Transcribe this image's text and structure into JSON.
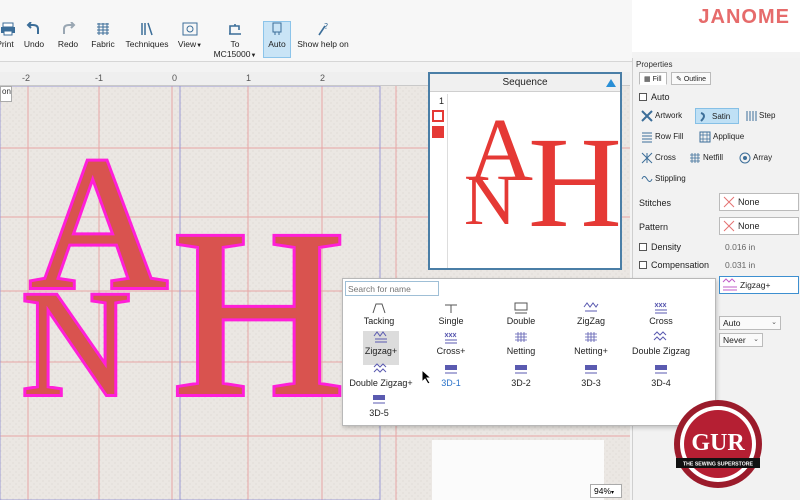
{
  "brand": "JANOME",
  "toolbar": {
    "items": [
      {
        "label": "Print",
        "icon": "print-icon"
      },
      {
        "label": "Undo",
        "icon": "undo-icon"
      },
      {
        "label": "Redo",
        "icon": "redo-icon"
      },
      {
        "label": "Fabric",
        "icon": "fabric-icon"
      },
      {
        "label": "Techniques",
        "icon": "techniques-icon"
      },
      {
        "label": "View",
        "icon": "view-icon"
      },
      {
        "label": "To MC15000",
        "icon": "machine-icon"
      },
      {
        "label": "Auto",
        "icon": "auto-icon",
        "active": true
      },
      {
        "label": "Show help on",
        "icon": "help-icon"
      }
    ]
  },
  "ruler": {
    "ticks": [
      "-2",
      "-1",
      "0",
      "1",
      "2"
    ]
  },
  "left_button": "on",
  "sequence": {
    "title": "Sequence",
    "item_number": "1",
    "letters": [
      "A",
      "N",
      "H"
    ]
  },
  "design": {
    "letters": [
      "A",
      "N",
      "H"
    ],
    "fill_color": "#d9534f",
    "outline_color": "#ff1fd8"
  },
  "properties": {
    "title": "Properties",
    "tabs": [
      "Fill",
      "Outline"
    ],
    "auto_label": "Auto",
    "fill_types": [
      "Artwork",
      "Satin",
      "Step",
      "Row Fill",
      "Applique",
      "Cross",
      "Netfill",
      "Array",
      "Stippling"
    ],
    "selected_fill": "Satin",
    "stitches_label": "Stitches",
    "stitches_value": "None",
    "pattern_label": "Pattern",
    "pattern_value": "None",
    "density_label": "Density",
    "density_value": "0.016 in",
    "compensation_label": "Compensation",
    "compensation_value": "0.031 in",
    "selected_stitch": "Zigzag+",
    "dropdown1": "Auto",
    "dropdown2": "Never"
  },
  "stitch_popup": {
    "search_placeholder": "Search for name",
    "items": [
      "Tacking",
      "Single",
      "Double",
      "ZigZag",
      "Cross",
      "Zigzag+",
      "Cross+",
      "Netting",
      "Netting+",
      "Double Zigzag",
      "Double Zigzag+",
      "3D-1",
      "3D-2",
      "3D-3",
      "3D-4",
      "3D-5"
    ],
    "selected": "Zigzag+",
    "hover": "3D-1"
  },
  "zoom": "94%",
  "logo": {
    "text": "GUR",
    "tagline": "THE SEWING SUPERSTORE"
  },
  "colors": {
    "accent": "#2a8fd6",
    "red": "#e53935",
    "magenta": "#ff1fd8"
  }
}
